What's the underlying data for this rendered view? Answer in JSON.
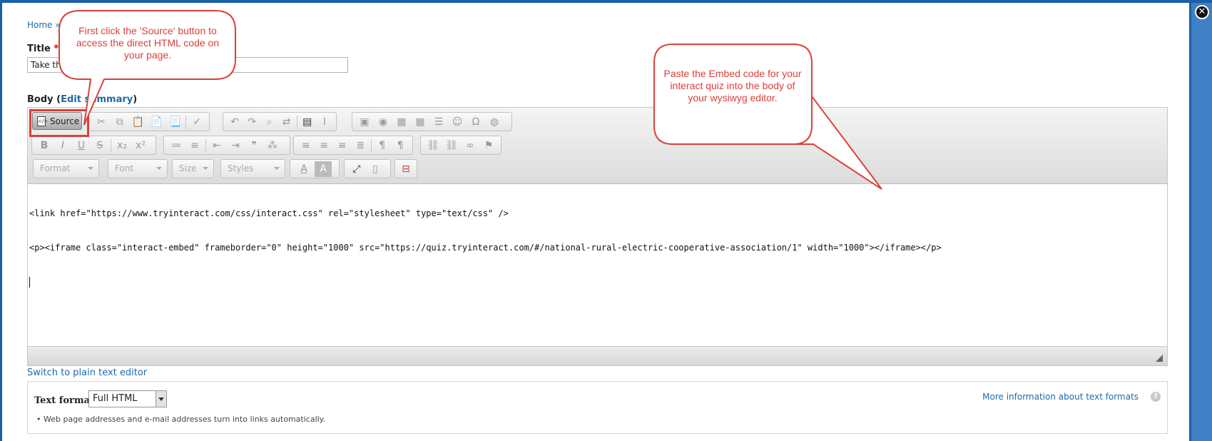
{
  "breadcrumb": {
    "home": "Home",
    "separator": "»"
  },
  "title_field": {
    "label": "Title",
    "required_mark": "*",
    "value": "Take th"
  },
  "body_field": {
    "label": "Body",
    "paren_open": "(",
    "edit_summary": "Edit summary",
    "paren_close": ")"
  },
  "toolbar": {
    "source_label": "Source",
    "format_combo": "Format",
    "font_combo": "Font",
    "size_combo": "Size",
    "styles_combo": "Styles",
    "text_color_glyph": "A",
    "bg_color_glyph": "A"
  },
  "editor_content": {
    "line1": "<link href=\"https://www.tryinteract.com/css/interact.css\" rel=\"stylesheet\" type=\"text/css\" />",
    "line2": "<p><iframe class=\"interact-embed\" frameborder=\"0\" height=\"1000\" src=\"https://quiz.tryinteract.com/#/national-rural-electric-cooperative-association/1\" width=\"1000\"></iframe></p>"
  },
  "switch_editor": "Switch to plain text editor",
  "text_format": {
    "label": "Text format",
    "selected": "Full HTML",
    "note": "Web page addresses and e-mail addresses turn into links automatically.",
    "more_info": "More information about text formats",
    "help_glyph": "?"
  },
  "callouts": {
    "source": "First click the 'Source' button to access the direct HTML code on your page.",
    "embed": "Paste the Embed code for your interact quiz into the body of your wysiwyg editor."
  },
  "colors": {
    "callout_red": "#d9413a",
    "link_blue": "#1f69a8",
    "frame_blue": "#1a5fa8"
  },
  "icons": {
    "close": "close-icon",
    "resize": "resize-grip-icon",
    "help": "help-icon"
  }
}
